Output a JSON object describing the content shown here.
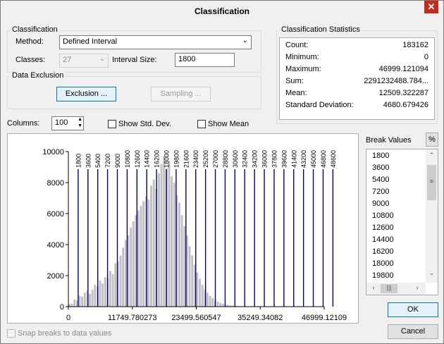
{
  "window": {
    "title": "Classification",
    "close_glyph": "✕"
  },
  "classification": {
    "group_label": "Classification",
    "method_label": "Method:",
    "method_value": "Defined Interval",
    "classes_label": "Classes:",
    "classes_value": "27",
    "interval_label": "Interval Size:",
    "interval_value": "1800"
  },
  "data_exclusion": {
    "group_label": "Data Exclusion",
    "exclusion_button": "Exclusion ...",
    "sampling_button": "Sampling ..."
  },
  "stats": {
    "group_label": "Classification Statistics",
    "rows": [
      {
        "label": "Count:",
        "value": "183162"
      },
      {
        "label": "Minimum:",
        "value": "0"
      },
      {
        "label": "Maximum:",
        "value": "46999.121094"
      },
      {
        "label": "Sum:",
        "value": "2291232488.784..."
      },
      {
        "label": "Mean:",
        "value": "12509.322287"
      },
      {
        "label": "Standard Deviation:",
        "value": "4680.679426"
      }
    ]
  },
  "options": {
    "columns_label": "Columns:",
    "columns_value": "100",
    "show_std_dev": "Show Std. Dev.",
    "show_mean": "Show Mean",
    "snap_breaks": "Snap breaks to data values"
  },
  "break_values": {
    "label": "Break Values",
    "percent_button": "%",
    "items": [
      "1800",
      "3600",
      "5400",
      "7200",
      "9000",
      "10800",
      "12600",
      "14400",
      "16200",
      "18000",
      "19800"
    ]
  },
  "buttons": {
    "ok": "OK",
    "cancel": "Cancel"
  },
  "colors": {
    "bar": "#c0c0c0",
    "break_line": "#00008b",
    "accent": "#0078d7"
  },
  "chart_data": {
    "type": "bar",
    "title": "",
    "xlabel": "",
    "ylabel": "",
    "xlim": [
      0,
      46999.121094
    ],
    "ylim": [
      0,
      10000
    ],
    "y_ticks": [
      "0",
      "2000",
      "4000",
      "6000",
      "8000",
      "10000"
    ],
    "x_ticks": [
      {
        "value": 0,
        "label": "0"
      },
      {
        "value": 11749.780273,
        "label": "11749.780273"
      },
      {
        "value": 23499.560547,
        "label": "23499.560547"
      },
      {
        "value": 35249.34082,
        "label": "35249.34082"
      },
      {
        "value": 46999.121094,
        "label": "46999.12109"
      }
    ],
    "bin_count": 100,
    "bin_width": 469.99,
    "values": [
      180,
      200,
      450,
      420,
      700,
      650,
      900,
      1050,
      820,
      1100,
      1400,
      1300,
      1700,
      1500,
      1900,
      1850,
      2300,
      2100,
      2800,
      2900,
      3300,
      3800,
      4300,
      4600,
      5100,
      5500,
      5900,
      6200,
      6500,
      6800,
      7100,
      6900,
      7800,
      8200,
      7600,
      8600,
      9200,
      9700,
      8900,
      9400,
      8400,
      8000,
      7200,
      6700,
      5900,
      5200,
      4600,
      3900,
      3300,
      2700,
      2200,
      1800,
      1400,
      1100,
      900,
      700,
      550,
      420,
      320,
      250,
      190,
      150,
      110,
      90,
      70,
      55,
      45,
      35,
      30,
      25,
      20,
      15,
      12,
      10,
      8,
      6,
      5,
      4,
      3,
      3,
      2,
      2,
      2,
      1,
      1,
      1,
      1,
      1,
      1,
      1,
      1,
      1,
      1,
      1,
      1,
      1,
      1,
      1,
      1,
      1
    ],
    "break_values": [
      1800,
      3600,
      5400,
      7200,
      9000,
      10800,
      12600,
      14400,
      16200,
      18000,
      19800,
      21600,
      23400,
      25200,
      27000,
      28800,
      30600,
      32400,
      34200,
      36000,
      37800,
      39600,
      41400,
      43200,
      45000,
      46800,
      48600
    ]
  }
}
